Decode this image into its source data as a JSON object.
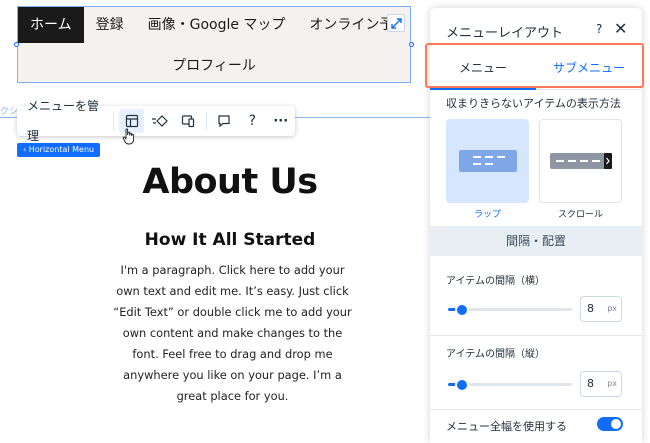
{
  "menu": {
    "items": [
      "ホーム",
      "登録",
      "画像・Google マップ",
      "オンライン予"
    ],
    "second_row": "プロフィール",
    "expand_icon": "diagonal-arrows-icon"
  },
  "canvas": {
    "guide_label": "クシ",
    "component_tag": "Horizontal Menu"
  },
  "toolbar": {
    "manage_label": "メニューを管理",
    "icons": [
      "layout-icon",
      "animation-icon",
      "mobile-desktop-icon",
      "comment-icon",
      "help-icon",
      "more-icon"
    ],
    "help_glyph": "?",
    "more_glyph": "···"
  },
  "page": {
    "title": "About Us",
    "subtitle": "How It All Started",
    "paragraph": "I'm a paragraph. Click here to add your own text and edit me. It’s easy. Just click “Edit Text” or double click me to add your own content and make changes to the font. Feel free to drag and drop me anywhere you like on your page. I’m a great place for you."
  },
  "panel": {
    "title": "メニューレイアウト",
    "help": "?",
    "close": "✕",
    "tabs": [
      "メニュー",
      "サブメニュー"
    ],
    "selected_tab": 0,
    "overflow_label": "収まりきらないアイテムの表示方法",
    "options": [
      {
        "label": "ラップ",
        "selected": true
      },
      {
        "label": "スクロール",
        "selected": false
      }
    ],
    "section_title": "間隔・配置",
    "spacing_h": {
      "label": "アイテムの間隔（横）",
      "value": "8",
      "unit": "px"
    },
    "spacing_v": {
      "label": "アイテムの間隔（縦）",
      "value": "8",
      "unit": "px"
    },
    "full_width": {
      "label": "メニュー全幅を使用する",
      "on": true
    }
  },
  "colors": {
    "accent": "#116dff",
    "highlight": "#ff7a59",
    "menu_bg": "#f5f1ee",
    "active_item": "#1a1a1a"
  }
}
